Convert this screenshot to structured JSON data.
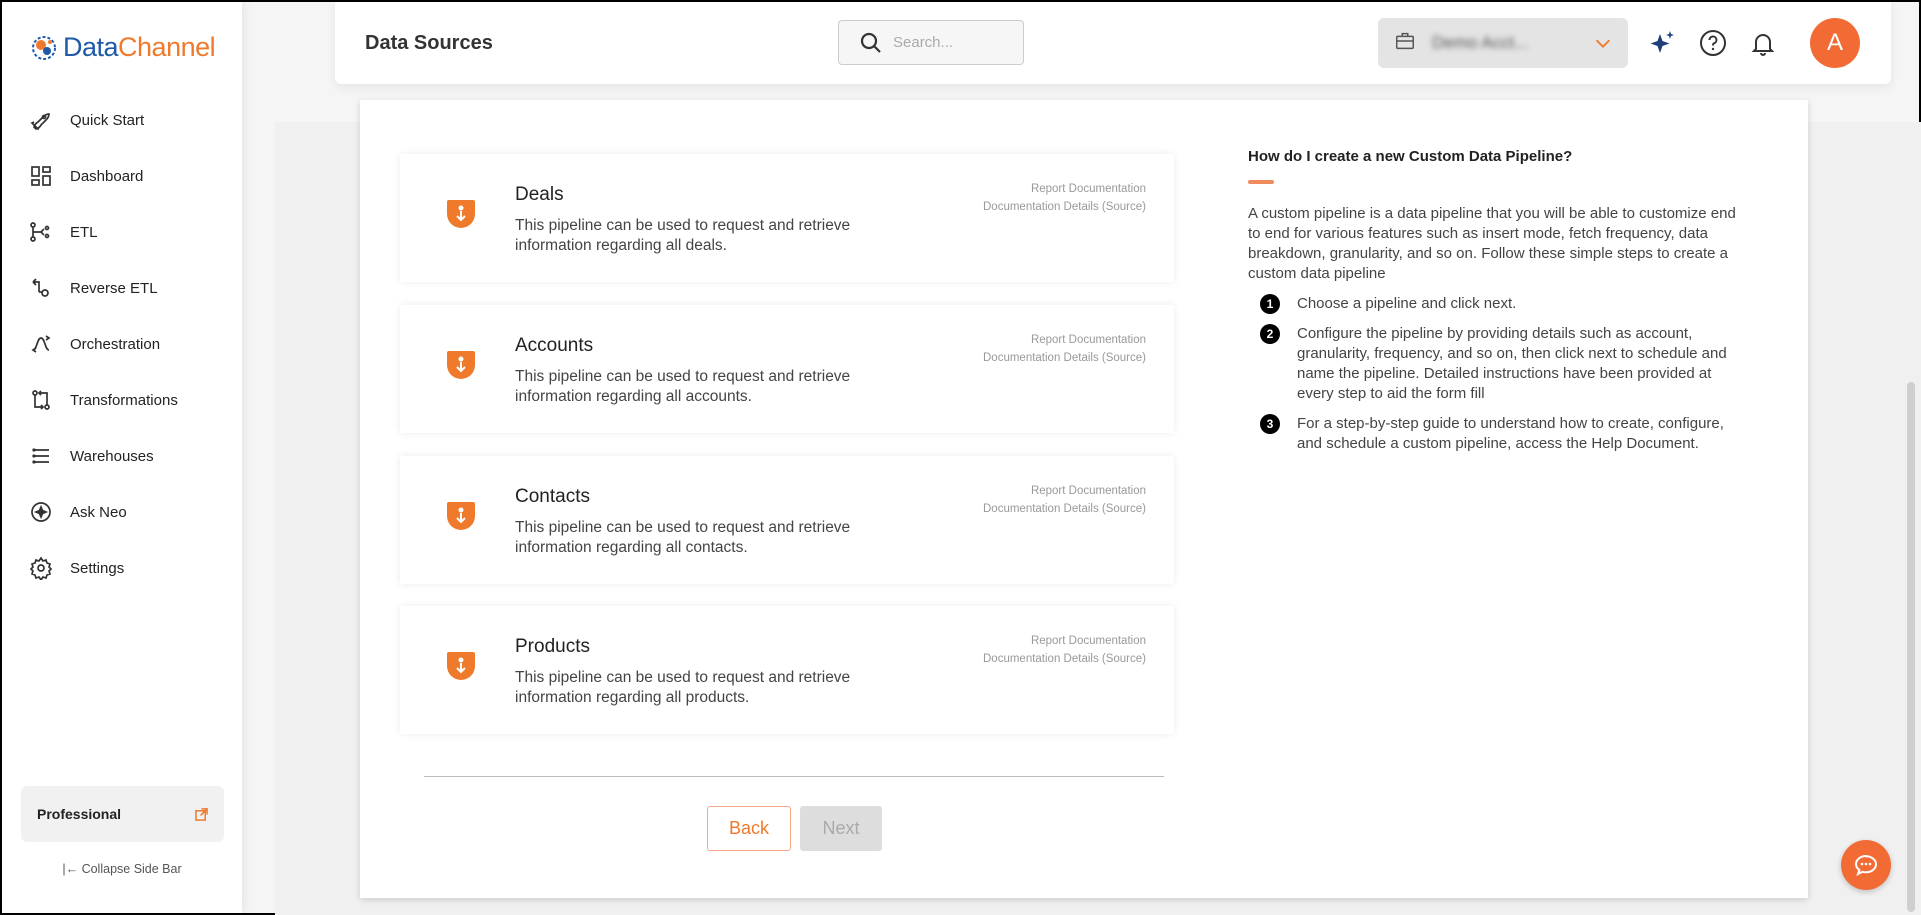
{
  "brand": {
    "name_part1": "Data",
    "name_part2": "Channel"
  },
  "sidebar": {
    "items": [
      {
        "label": "Quick Start",
        "icon": "rocket-icon"
      },
      {
        "label": "Dashboard",
        "icon": "dashboard-icon"
      },
      {
        "label": "ETL",
        "icon": "etl-icon"
      },
      {
        "label": "Reverse ETL",
        "icon": "reverse-etl-icon"
      },
      {
        "label": "Orchestration",
        "icon": "orchestration-icon"
      },
      {
        "label": "Transformations",
        "icon": "transformations-icon"
      },
      {
        "label": "Warehouses",
        "icon": "warehouses-icon"
      },
      {
        "label": "Ask Neo",
        "icon": "ask-neo-icon"
      },
      {
        "label": "Settings",
        "icon": "gear-icon"
      }
    ],
    "plan": "Professional",
    "collapse_label": "Collapse Side Bar"
  },
  "header": {
    "title": "Data Sources",
    "search_placeholder": "Search...",
    "workspace_name": "Demo Acct...",
    "avatar_letter": "A"
  },
  "pipelines": [
    {
      "title": "Deals",
      "description": "This pipeline can be used to request and retrieve information regarding all deals.",
      "link1": "Report Documentation",
      "link2": "Documentation Details (Source)"
    },
    {
      "title": "Accounts",
      "description": "This pipeline can be used to request and retrieve information regarding all accounts.",
      "link1": "Report Documentation",
      "link2": "Documentation Details (Source)"
    },
    {
      "title": "Contacts",
      "description": "This pipeline can be used to request and retrieve information regarding all contacts.",
      "link1": "Report Documentation",
      "link2": "Documentation Details (Source)"
    },
    {
      "title": "Products",
      "description": "This pipeline can be used to request and retrieve information regarding all products.",
      "link1": "Report Documentation",
      "link2": "Documentation Details (Source)"
    }
  ],
  "buttons": {
    "back": "Back",
    "next": "Next"
  },
  "help": {
    "title": "How do I create a new Custom Data Pipeline?",
    "body": "A custom pipeline is a data pipeline that you will be able to customize end to end for various features such as insert mode, fetch frequency, data breakdown, granularity, and so on. Follow these simple steps to create a custom data pipeline",
    "steps": [
      {
        "num": "1",
        "text": "Choose a pipeline and click next."
      },
      {
        "num": "2",
        "text": "Configure the pipeline by providing details such as account, granularity, frequency, and so on, then click next to schedule and name the pipeline. Detailed instructions have been provided at every step to aid the form fill"
      },
      {
        "num": "3",
        "text": "For a step-by-step guide to understand how to create, configure, and schedule a custom pipeline, access the Help Document."
      }
    ]
  },
  "colors": {
    "accent": "#ef7a2b",
    "brand_blue": "#1e5aa8",
    "avatar": "#f26b35"
  }
}
